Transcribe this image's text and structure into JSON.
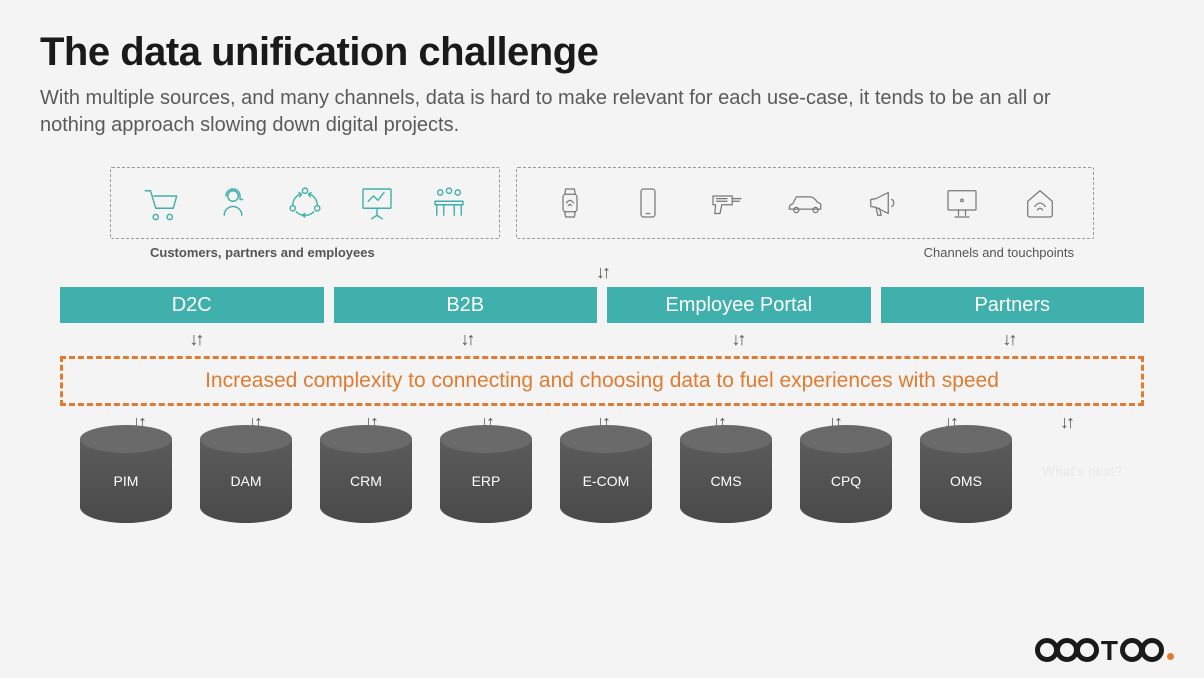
{
  "header": {
    "title": "The data unification challenge",
    "subtitle": "With multiple sources, and many channels, data is hard to make relevant for each use-case, it tends to be an all or nothing approach slowing down digital projects."
  },
  "top": {
    "left_caption": "Customers, partners and employees",
    "right_caption": "Channels and touchpoints",
    "left_icons": [
      "cart-icon",
      "headset-person-icon",
      "people-cycle-icon",
      "presentation-icon",
      "meeting-table-icon"
    ],
    "right_icons": [
      "smartwatch-icon",
      "smartphone-icon",
      "drill-icon",
      "car-icon",
      "megaphone-icon",
      "desktop-icon",
      "smart-home-icon"
    ]
  },
  "channels": [
    "D2C",
    "B2B",
    "Employee Portal",
    "Partners"
  ],
  "complexity_text": "Increased complexity to connecting and choosing data to fuel experiences with speed",
  "cylinders": [
    "PIM",
    "DAM",
    "CRM",
    "ERP",
    "E-COM",
    "CMS",
    "CPQ",
    "OMS"
  ],
  "whats_next": "What's next?",
  "logo": {
    "text": "occtoo"
  },
  "arrow_glyph": "↓↑"
}
